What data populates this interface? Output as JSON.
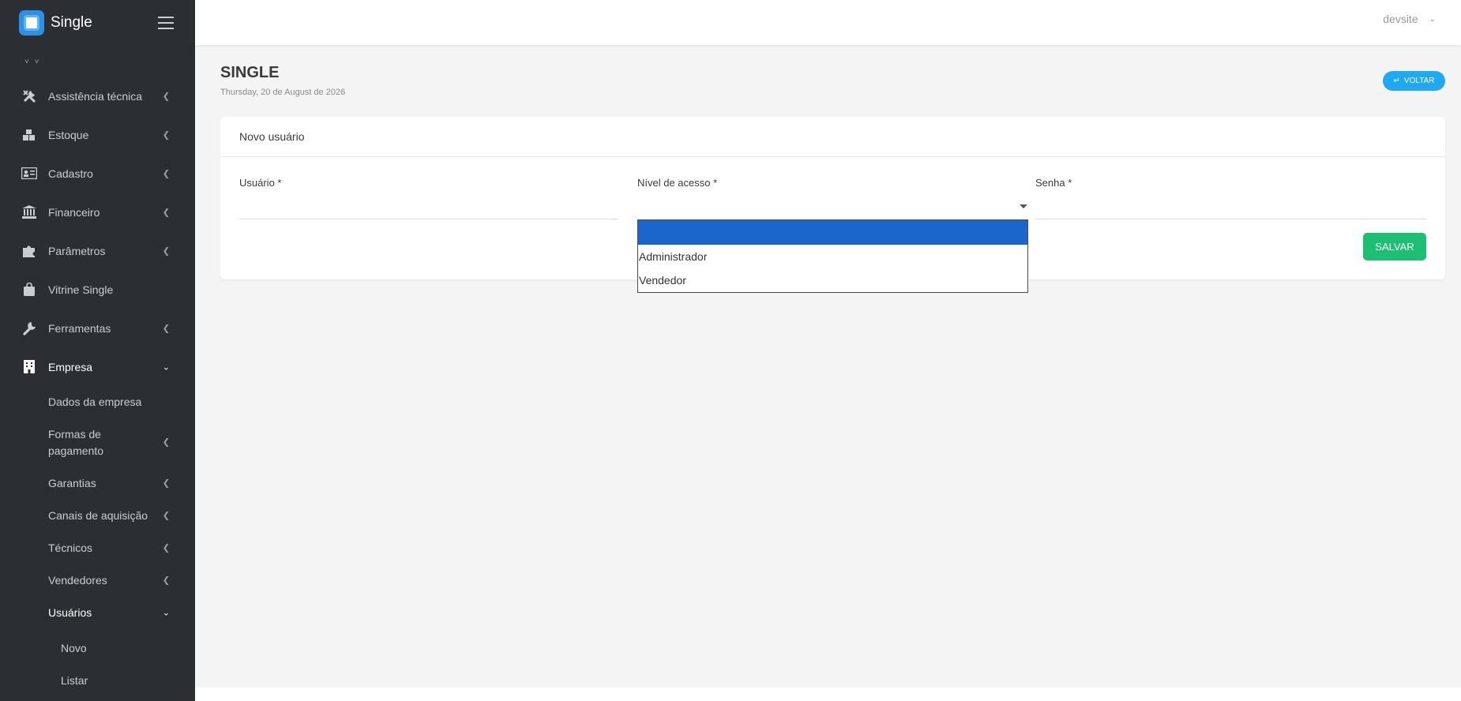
{
  "app": {
    "name": "Single"
  },
  "sidebar": {
    "scroll_hint": "˅ ˅",
    "items": [
      {
        "label": "Assistência técnica",
        "icon": "tools-icon",
        "has_children": true
      },
      {
        "label": "Estoque",
        "icon": "boxes-icon",
        "has_children": true
      },
      {
        "label": "Cadastro",
        "icon": "id-card-icon",
        "has_children": true
      },
      {
        "label": "Financeiro",
        "icon": "bank-icon",
        "has_children": true
      },
      {
        "label": "Parâmetros",
        "icon": "puzzle-icon",
        "has_children": true
      },
      {
        "label": "Vitrine Single",
        "icon": "shopping-bag-icon",
        "has_children": false
      },
      {
        "label": "Ferramentas",
        "icon": "wrench-icon",
        "has_children": true
      },
      {
        "label": "Empresa",
        "icon": "building-icon",
        "has_children": true,
        "expanded": true
      }
    ],
    "empresa_sub": [
      {
        "label": "Dados da empresa",
        "has_children": false
      },
      {
        "label": "Formas de pagamento",
        "has_children": true
      },
      {
        "label": "Garantias",
        "has_children": true
      },
      {
        "label": "Canais de aquisição",
        "has_children": true
      },
      {
        "label": "Técnicos",
        "has_children": true
      },
      {
        "label": "Vendedores",
        "has_children": true
      },
      {
        "label": "Usuários",
        "has_children": true,
        "expanded": true
      }
    ],
    "usuarios_sub": [
      {
        "label": "Novo"
      },
      {
        "label": "Listar"
      }
    ]
  },
  "topbar": {
    "user": "devsite"
  },
  "page": {
    "title": "SINGLE",
    "date": "Thursday, 20 de August de 2026",
    "back_label": "VOLTAR"
  },
  "form": {
    "title": "Novo usuário",
    "fields": {
      "usuario": {
        "label": "Usuário *",
        "value": ""
      },
      "nivel": {
        "label": "Nível de acesso *",
        "value": ""
      },
      "senha": {
        "label": "Senha *",
        "value": ""
      }
    },
    "save_label": "SALVAR",
    "nivel_options": [
      "",
      "Administrador",
      "Vendedor"
    ]
  },
  "colors": {
    "sidebar_bg": "#2b2f33",
    "accent_blue": "#20a9f3",
    "save_green": "#1dbf73",
    "option_selected": "#1a66cc"
  }
}
